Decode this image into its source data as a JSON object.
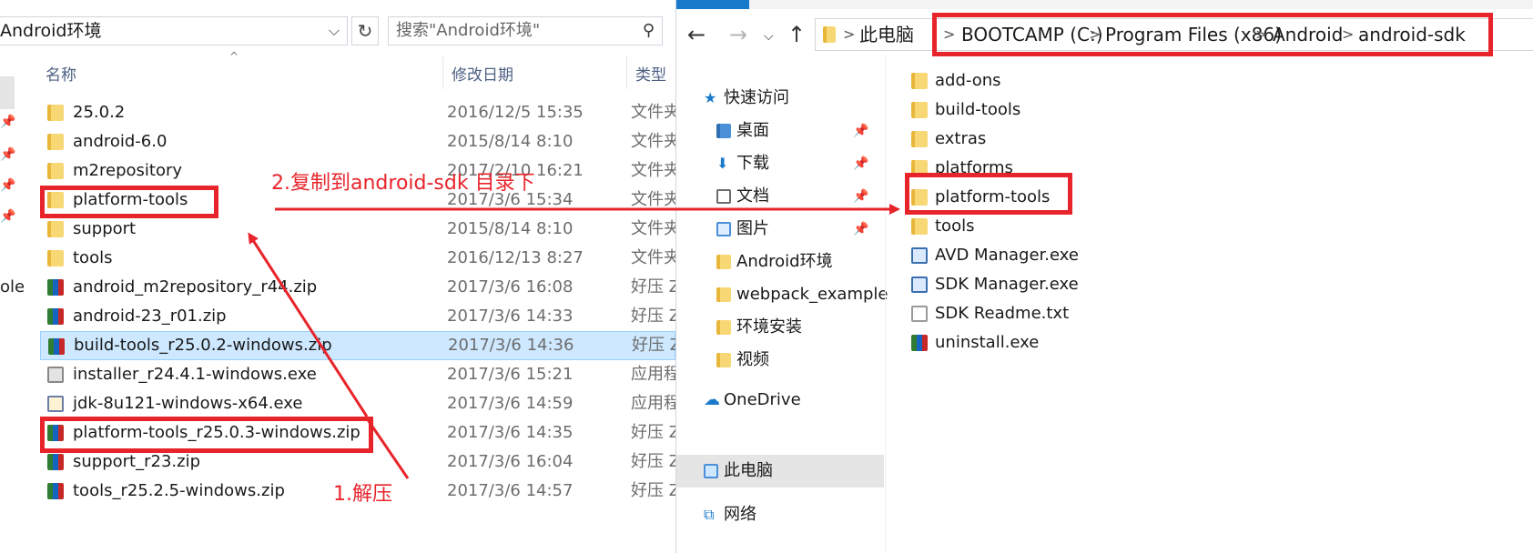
{
  "left": {
    "address": "Android环境",
    "search_placeholder": "搜索\"Android环境\"",
    "edge_text": "ole",
    "columns": {
      "name": "名称",
      "date": "修改日期",
      "type": "类型"
    },
    "rows": [
      {
        "name": "25.0.2",
        "date": "2016/12/5 15:35",
        "type": "文件夹",
        "icon": "folder"
      },
      {
        "name": "android-6.0",
        "date": "2015/8/14 8:10",
        "type": "文件夹",
        "icon": "folder"
      },
      {
        "name": "m2repository",
        "date": "2017/2/10 16:21",
        "type": "文件夹",
        "icon": "folder"
      },
      {
        "name": "platform-tools",
        "date": "2017/3/6 15:34",
        "type": "文件夹",
        "icon": "folder"
      },
      {
        "name": "support",
        "date": "2015/8/14 8:10",
        "type": "文件夹",
        "icon": "folder"
      },
      {
        "name": "tools",
        "date": "2016/12/13 8:27",
        "type": "文件夹",
        "icon": "folder"
      },
      {
        "name": "android_m2repository_r44.zip",
        "date": "2017/3/6 16:08",
        "type": "好压 Z",
        "icon": "zip"
      },
      {
        "name": "android-23_r01.zip",
        "date": "2017/3/6 14:33",
        "type": "好压 Z",
        "icon": "zip"
      },
      {
        "name": "build-tools_r25.0.2-windows.zip",
        "date": "2017/3/6 14:36",
        "type": "好压 Z",
        "icon": "zip"
      },
      {
        "name": "installer_r24.4.1-windows.exe",
        "date": "2017/3/6 15:21",
        "type": "应用程",
        "icon": "exe"
      },
      {
        "name": "jdk-8u121-windows-x64.exe",
        "date": "2017/3/6 14:59",
        "type": "应用程",
        "icon": "jdk"
      },
      {
        "name": "platform-tools_r25.0.3-windows.zip",
        "date": "2017/3/6 14:35",
        "type": "好压 Z",
        "icon": "zip"
      },
      {
        "name": "support_r23.zip",
        "date": "2017/3/6 16:04",
        "type": "好压 Z",
        "icon": "zip"
      },
      {
        "name": "tools_r25.2.5-windows.zip",
        "date": "2017/3/6 14:57",
        "type": "好压 Z",
        "icon": "zip"
      }
    ],
    "selected_row": 8
  },
  "right": {
    "breadcrumb": [
      "此电脑",
      "BOOTCAMP (C:)",
      "Program Files (x86)",
      "Android",
      "android-sdk"
    ],
    "nav": {
      "quick_access": "快速访问",
      "desktop": "桌面",
      "downloads": "下载",
      "documents": "文档",
      "pictures": "图片",
      "android_env": "Android环境",
      "webpack": "webpack_example",
      "env_setup": "环境安装",
      "videos": "视频",
      "onedrive": "OneDrive",
      "this_pc": "此电脑",
      "network": "网络"
    },
    "files": [
      {
        "name": "add-ons",
        "icon": "folder"
      },
      {
        "name": "build-tools",
        "icon": "folder"
      },
      {
        "name": "extras",
        "icon": "folder"
      },
      {
        "name": "platforms",
        "icon": "folder"
      },
      {
        "name": "platform-tools",
        "icon": "folder"
      },
      {
        "name": "tools",
        "icon": "folder"
      },
      {
        "name": "AVD Manager.exe",
        "icon": "app"
      },
      {
        "name": "SDK Manager.exe",
        "icon": "app"
      },
      {
        "name": "SDK Readme.txt",
        "icon": "txt"
      },
      {
        "name": "uninstall.exe",
        "icon": "setup"
      }
    ]
  },
  "annotations": {
    "step1": "1.解压",
    "step2": "2.复制到android-sdk 目录下",
    "color": "#e8242b"
  },
  "icons": {
    "back": "back-arrow-icon",
    "forward": "forward-arrow-icon",
    "up": "up-arrow-icon",
    "refresh": "refresh-icon",
    "search": "search-icon",
    "pin": "pin-icon"
  }
}
